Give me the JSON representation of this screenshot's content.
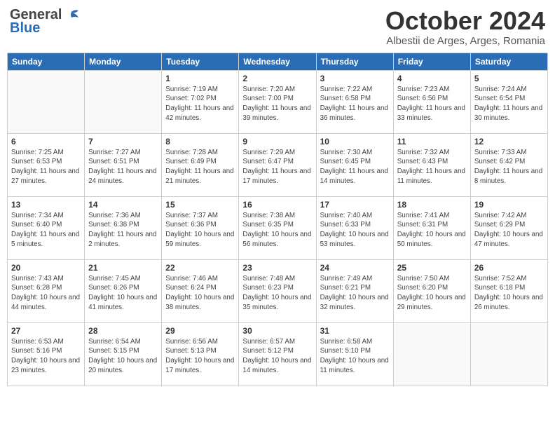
{
  "header": {
    "logo_general": "General",
    "logo_blue": "Blue",
    "month": "October 2024",
    "location": "Albestii de Arges, Arges, Romania"
  },
  "weekdays": [
    "Sunday",
    "Monday",
    "Tuesday",
    "Wednesday",
    "Thursday",
    "Friday",
    "Saturday"
  ],
  "weeks": [
    [
      {
        "day": "",
        "info": ""
      },
      {
        "day": "",
        "info": ""
      },
      {
        "day": "1",
        "info": "Sunrise: 7:19 AM\nSunset: 7:02 PM\nDaylight: 11 hours and 42 minutes."
      },
      {
        "day": "2",
        "info": "Sunrise: 7:20 AM\nSunset: 7:00 PM\nDaylight: 11 hours and 39 minutes."
      },
      {
        "day": "3",
        "info": "Sunrise: 7:22 AM\nSunset: 6:58 PM\nDaylight: 11 hours and 36 minutes."
      },
      {
        "day": "4",
        "info": "Sunrise: 7:23 AM\nSunset: 6:56 PM\nDaylight: 11 hours and 33 minutes."
      },
      {
        "day": "5",
        "info": "Sunrise: 7:24 AM\nSunset: 6:54 PM\nDaylight: 11 hours and 30 minutes."
      }
    ],
    [
      {
        "day": "6",
        "info": "Sunrise: 7:25 AM\nSunset: 6:53 PM\nDaylight: 11 hours and 27 minutes."
      },
      {
        "day": "7",
        "info": "Sunrise: 7:27 AM\nSunset: 6:51 PM\nDaylight: 11 hours and 24 minutes."
      },
      {
        "day": "8",
        "info": "Sunrise: 7:28 AM\nSunset: 6:49 PM\nDaylight: 11 hours and 21 minutes."
      },
      {
        "day": "9",
        "info": "Sunrise: 7:29 AM\nSunset: 6:47 PM\nDaylight: 11 hours and 17 minutes."
      },
      {
        "day": "10",
        "info": "Sunrise: 7:30 AM\nSunset: 6:45 PM\nDaylight: 11 hours and 14 minutes."
      },
      {
        "day": "11",
        "info": "Sunrise: 7:32 AM\nSunset: 6:43 PM\nDaylight: 11 hours and 11 minutes."
      },
      {
        "day": "12",
        "info": "Sunrise: 7:33 AM\nSunset: 6:42 PM\nDaylight: 11 hours and 8 minutes."
      }
    ],
    [
      {
        "day": "13",
        "info": "Sunrise: 7:34 AM\nSunset: 6:40 PM\nDaylight: 11 hours and 5 minutes."
      },
      {
        "day": "14",
        "info": "Sunrise: 7:36 AM\nSunset: 6:38 PM\nDaylight: 11 hours and 2 minutes."
      },
      {
        "day": "15",
        "info": "Sunrise: 7:37 AM\nSunset: 6:36 PM\nDaylight: 10 hours and 59 minutes."
      },
      {
        "day": "16",
        "info": "Sunrise: 7:38 AM\nSunset: 6:35 PM\nDaylight: 10 hours and 56 minutes."
      },
      {
        "day": "17",
        "info": "Sunrise: 7:40 AM\nSunset: 6:33 PM\nDaylight: 10 hours and 53 minutes."
      },
      {
        "day": "18",
        "info": "Sunrise: 7:41 AM\nSunset: 6:31 PM\nDaylight: 10 hours and 50 minutes."
      },
      {
        "day": "19",
        "info": "Sunrise: 7:42 AM\nSunset: 6:29 PM\nDaylight: 10 hours and 47 minutes."
      }
    ],
    [
      {
        "day": "20",
        "info": "Sunrise: 7:43 AM\nSunset: 6:28 PM\nDaylight: 10 hours and 44 minutes."
      },
      {
        "day": "21",
        "info": "Sunrise: 7:45 AM\nSunset: 6:26 PM\nDaylight: 10 hours and 41 minutes."
      },
      {
        "day": "22",
        "info": "Sunrise: 7:46 AM\nSunset: 6:24 PM\nDaylight: 10 hours and 38 minutes."
      },
      {
        "day": "23",
        "info": "Sunrise: 7:48 AM\nSunset: 6:23 PM\nDaylight: 10 hours and 35 minutes."
      },
      {
        "day": "24",
        "info": "Sunrise: 7:49 AM\nSunset: 6:21 PM\nDaylight: 10 hours and 32 minutes."
      },
      {
        "day": "25",
        "info": "Sunrise: 7:50 AM\nSunset: 6:20 PM\nDaylight: 10 hours and 29 minutes."
      },
      {
        "day": "26",
        "info": "Sunrise: 7:52 AM\nSunset: 6:18 PM\nDaylight: 10 hours and 26 minutes."
      }
    ],
    [
      {
        "day": "27",
        "info": "Sunrise: 6:53 AM\nSunset: 5:16 PM\nDaylight: 10 hours and 23 minutes."
      },
      {
        "day": "28",
        "info": "Sunrise: 6:54 AM\nSunset: 5:15 PM\nDaylight: 10 hours and 20 minutes."
      },
      {
        "day": "29",
        "info": "Sunrise: 6:56 AM\nSunset: 5:13 PM\nDaylight: 10 hours and 17 minutes."
      },
      {
        "day": "30",
        "info": "Sunrise: 6:57 AM\nSunset: 5:12 PM\nDaylight: 10 hours and 14 minutes."
      },
      {
        "day": "31",
        "info": "Sunrise: 6:58 AM\nSunset: 5:10 PM\nDaylight: 10 hours and 11 minutes."
      },
      {
        "day": "",
        "info": ""
      },
      {
        "day": "",
        "info": ""
      }
    ]
  ]
}
